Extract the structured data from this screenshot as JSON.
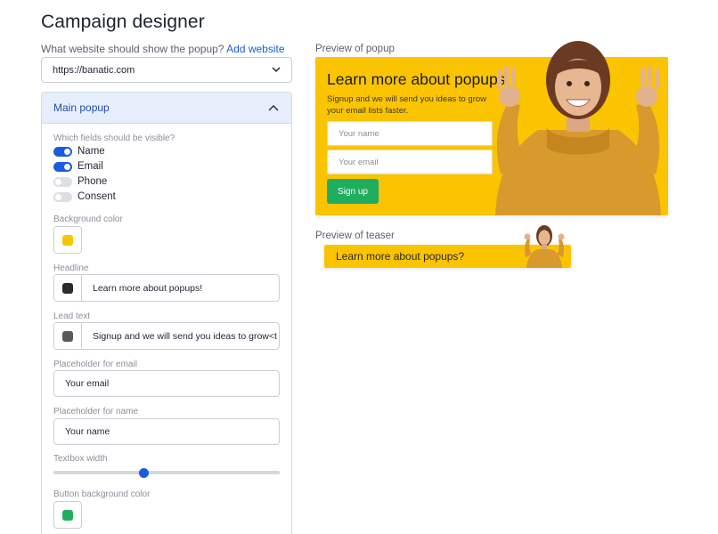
{
  "page": {
    "title": "Campaign designer"
  },
  "website": {
    "question": "What website should show the popup?",
    "add_link": "Add website",
    "selected": "https://banatic.com"
  },
  "main_popup": {
    "header": "Main popup",
    "fields_label": "Which fields should be visible?",
    "fields": [
      {
        "label": "Name",
        "on": true
      },
      {
        "label": "Email",
        "on": true
      },
      {
        "label": "Phone",
        "on": false
      },
      {
        "label": "Consent",
        "on": false
      }
    ],
    "background_color_label": "Background color",
    "background_color": "#fbc400",
    "headline_label": "Headline",
    "headline_value": "Learn more about popups!",
    "headline_color": "#2b2b2b",
    "lead_label": "Lead text",
    "lead_value": "Signup and we will send you ideas to grow<t",
    "lead_color": "#5a5a5a",
    "email_placeholder_label": "Placeholder for email",
    "email_placeholder_value": "Your email",
    "name_placeholder_label": "Placeholder for name",
    "name_placeholder_value": "Your name",
    "textbox_width_label": "Textbox width",
    "textbox_width_fraction": 0.4,
    "button_bg_label": "Button background color",
    "button_bg_color": "#1fae5f"
  },
  "preview_popup": {
    "label": "Preview of popup",
    "headline": "Learn more about popups!",
    "lead": "Signup and we will send you ideas to grow your email lists faster.",
    "name_placeholder": "Your name",
    "email_placeholder": "Your email",
    "button": "Sign up"
  },
  "preview_teaser": {
    "label": "Preview of teaser",
    "text": "Learn more about popups?"
  },
  "colors": {
    "accent": "#1a5ce0",
    "popup_bg": "#fbc400",
    "button_green": "#1fae5f"
  }
}
